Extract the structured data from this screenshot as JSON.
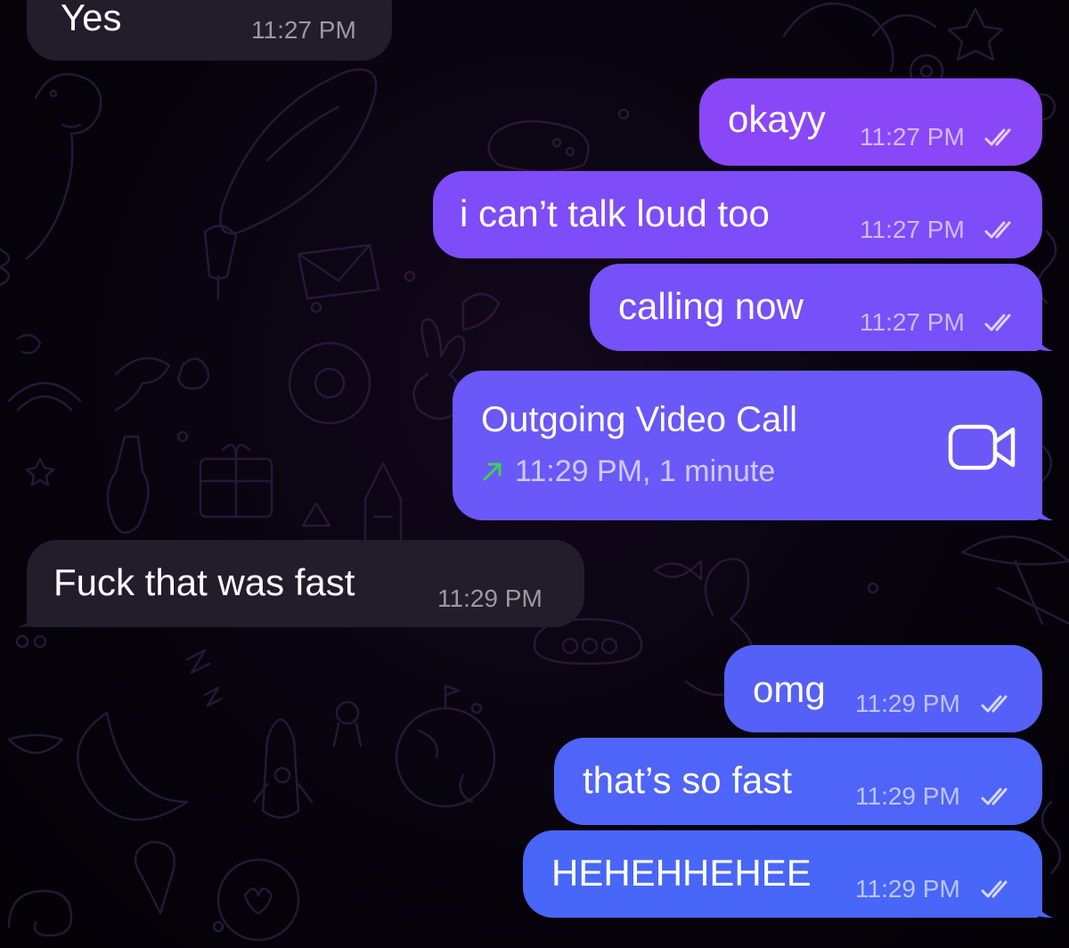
{
  "messages": [
    {
      "direction": "in",
      "text": "Yes",
      "time": "11:27 PM"
    },
    {
      "direction": "out",
      "text": "okayy",
      "time": "11:27 PM",
      "status": "read"
    },
    {
      "direction": "out",
      "text": "i can’t talk loud too",
      "time": "11:27 PM",
      "status": "read"
    },
    {
      "direction": "out",
      "text": "calling now",
      "time": "11:27 PM",
      "status": "read"
    },
    {
      "direction": "in",
      "text": "Fuck that was fast",
      "time": "11:29 PM"
    },
    {
      "direction": "out",
      "text": "omg",
      "time": "11:29 PM",
      "status": "read"
    },
    {
      "direction": "out",
      "text": "that’s so fast",
      "time": "11:29 PM",
      "status": "read"
    },
    {
      "direction": "out",
      "text": "HEHEHHEHEE",
      "time": "11:29 PM",
      "status": "read"
    }
  ],
  "call": {
    "title": "Outgoing Video Call",
    "detail": "11:29 PM, 1 minute",
    "direction_icon": "outgoing-arrow-icon",
    "type_icon": "video-camera-icon"
  },
  "colors": {
    "incoming_bubble": "#231c2a",
    "outgoing_gradient_top": "#9a45f8",
    "outgoing_gradient_bottom": "#4664f8",
    "call_arrow": "#3fcf5a"
  }
}
